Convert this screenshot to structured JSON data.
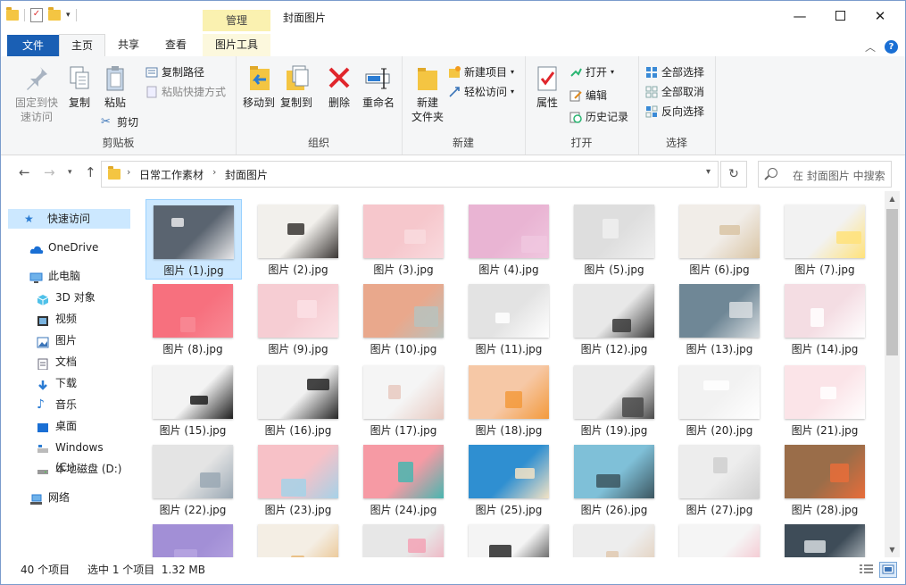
{
  "titlebar": {
    "window_title": "封面图片",
    "context_tab": "管理",
    "controls": {
      "minimize": "—",
      "close": "✕"
    },
    "qat_dropdown": "▾"
  },
  "ribbon_tabs": [
    "文件",
    "主页",
    "共享",
    "查看",
    "图片工具"
  ],
  "ribbon": {
    "clipboard": {
      "title": "剪贴板",
      "pin": "固定到快\n速访问",
      "copy": "复制",
      "paste": "粘贴",
      "copy_path": "复制路径",
      "paste_shortcut": "粘贴快捷方式",
      "cut": "剪切"
    },
    "organize": {
      "title": "组织",
      "move_to": "移动到",
      "copy_to": "复制到",
      "delete": "删除",
      "rename": "重命名"
    },
    "new": {
      "title": "新建",
      "new_folder": "新建\n文件夹",
      "new_item": "新建项目",
      "easy_access": "轻松访问"
    },
    "open": {
      "title": "打开",
      "properties": "属性",
      "open": "打开",
      "edit": "编辑",
      "history": "历史记录"
    },
    "select": {
      "title": "选择",
      "select_all": "全部选择",
      "select_none": "全部取消",
      "invert": "反向选择"
    }
  },
  "address": {
    "crumbs": [
      "日常工作素材",
      "封面图片"
    ],
    "search_placeholder": "在 封面图片 中搜索"
  },
  "nav_pane": [
    {
      "label": "快速访问",
      "icon": "star-icon"
    },
    {
      "label": "OneDrive",
      "icon": "cloud-icon"
    },
    {
      "label": "此电脑",
      "icon": "computer-icon"
    },
    {
      "label": "3D 对象",
      "icon": "cube-icon"
    },
    {
      "label": "视频",
      "icon": "video-icon"
    },
    {
      "label": "图片",
      "icon": "picture-icon"
    },
    {
      "label": "文档",
      "icon": "document-icon"
    },
    {
      "label": "下载",
      "icon": "download-icon"
    },
    {
      "label": "音乐",
      "icon": "music-icon"
    },
    {
      "label": "桌面",
      "icon": "desktop-icon"
    },
    {
      "label": "Windows (C:)",
      "icon": "drive-windows-icon"
    },
    {
      "label": "本地磁盘 (D:)",
      "icon": "drive-icon"
    },
    {
      "label": "网络",
      "icon": "network-icon"
    }
  ],
  "files": [
    {
      "name": "图片 (1).jpg",
      "c1": "#5a6470",
      "c2": "#e8e8ea"
    },
    {
      "name": "图片 (2).jpg",
      "c1": "#f2f0ec",
      "c2": "#3a3634"
    },
    {
      "name": "图片 (3).jpg",
      "c1": "#f6c7cc",
      "c2": "#f9dade"
    },
    {
      "name": "图片 (4).jpg",
      "c1": "#e9b4d3",
      "c2": "#f0c7df"
    },
    {
      "name": "图片 (5).jpg",
      "c1": "#dedede",
      "c2": "#f0f0f0"
    },
    {
      "name": "图片 (6).jpg",
      "c1": "#f1ede8",
      "c2": "#d9c4a4"
    },
    {
      "name": "图片 (7).jpg",
      "c1": "#f2f2f2",
      "c2": "#ffe27a"
    },
    {
      "name": "图片 (8).jpg",
      "c1": "#f7707e",
      "c2": "#f88a95"
    },
    {
      "name": "图片 (9).jpg",
      "c1": "#f6cdd3",
      "c2": "#fbe1e5"
    },
    {
      "name": "图片 (10).jpg",
      "c1": "#e9a88c",
      "c2": "#b9c2bd"
    },
    {
      "name": "图片 (11).jpg",
      "c1": "#e3e3e3",
      "c2": "#ffffff"
    },
    {
      "name": "图片 (12).jpg",
      "c1": "#e8e8e8",
      "c2": "#3a3a3a"
    },
    {
      "name": "图片 (13).jpg",
      "c1": "#6f8796",
      "c2": "#d8dde0"
    },
    {
      "name": "图片 (14).jpg",
      "c1": "#f4dde3",
      "c2": "#ffffff"
    },
    {
      "name": "图片 (15).jpg",
      "c1": "#f3f3f3",
      "c2": "#1d1d1d"
    },
    {
      "name": "图片 (16).jpg",
      "c1": "#f1f1f1",
      "c2": "#262626"
    },
    {
      "name": "图片 (17).jpg",
      "c1": "#f5f5f5",
      "c2": "#e8c9c0"
    },
    {
      "name": "图片 (18).jpg",
      "c1": "#f6c8a6",
      "c2": "#f39a3c"
    },
    {
      "name": "图片 (19).jpg",
      "c1": "#ebebeb",
      "c2": "#4a4a4a"
    },
    {
      "name": "图片 (20).jpg",
      "c1": "#f2f2f2",
      "c2": "#ffffff"
    },
    {
      "name": "图片 (21).jpg",
      "c1": "#fbe4e8",
      "c2": "#ffffff"
    },
    {
      "name": "图片 (22).jpg",
      "c1": "#e4e4e4",
      "c2": "#9aa8b4"
    },
    {
      "name": "图片 (23).jpg",
      "c1": "#f7c1c7",
      "c2": "#a5d2e8"
    },
    {
      "name": "图片 (24).jpg",
      "c1": "#f69aa4",
      "c2": "#49b6b0"
    },
    {
      "name": "图片 (25).jpg",
      "c1": "#2f8fd1",
      "c2": "#f3e3c5"
    },
    {
      "name": "图片 (26).jpg",
      "c1": "#7fc0d8",
      "c2": "#3c5660"
    },
    {
      "name": "图片 (27).jpg",
      "c1": "#ededed",
      "c2": "#cfcfcf"
    },
    {
      "name": "图片 (28).jpg",
      "c1": "#9a6d49",
      "c2": "#e86d3a"
    },
    {
      "name": "",
      "c1": "#a28fd6",
      "c2": "#b7a6e2"
    },
    {
      "name": "",
      "c1": "#f4eee4",
      "c2": "#e8b877"
    },
    {
      "name": "",
      "c1": "#e7e7e7",
      "c2": "#f3a2b5"
    },
    {
      "name": "",
      "c1": "#f4f4f4",
      "c2": "#2a2a2a"
    },
    {
      "name": "",
      "c1": "#ededed",
      "c2": "#e1c9b0"
    },
    {
      "name": "",
      "c1": "#f5f5f5",
      "c2": "#f5b8c4"
    },
    {
      "name": "",
      "c1": "#3e4c58",
      "c2": "#d6dcdf"
    },
    {
      "name": "",
      "c1": "#f0f0f0",
      "c2": "#e2c6a3"
    }
  ],
  "status": {
    "count": "40 个项目",
    "selection": "选中 1 个项目  1.32 MB"
  },
  "colors": {
    "accent": "#1a5fb4",
    "selection": "#cce8ff",
    "context_tab": "#faf1b0"
  }
}
